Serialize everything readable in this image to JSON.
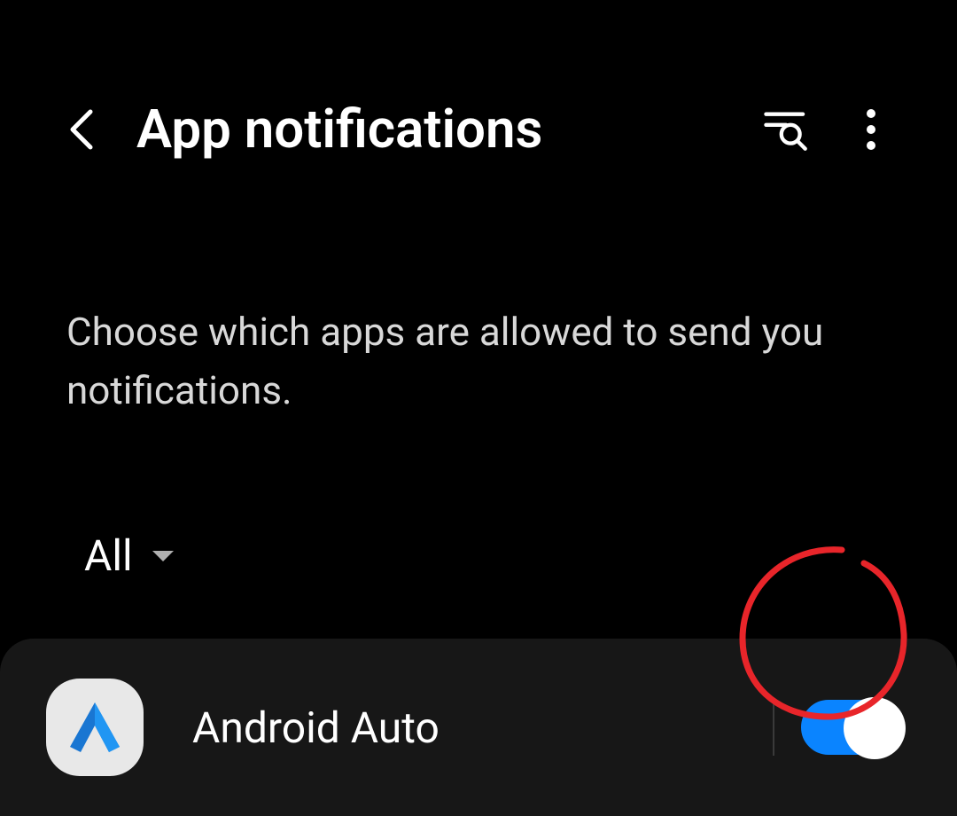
{
  "header": {
    "title": "App notifications"
  },
  "description": "Choose which apps are allowed to send you notifications.",
  "filter": {
    "selected": "All"
  },
  "apps": [
    {
      "name": "Android Auto",
      "enabled": true
    }
  ]
}
